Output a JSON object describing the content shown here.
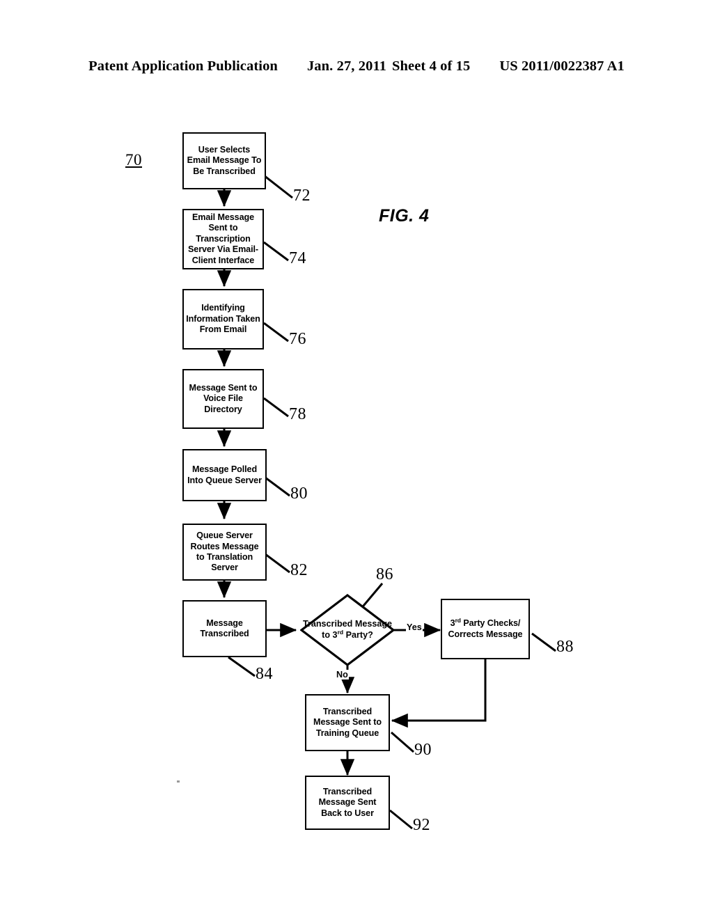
{
  "header": {
    "publication": "Patent Application Publication",
    "date": "Jan. 27, 2011",
    "sheet": "Sheet 4 of 15",
    "number": "US 2011/0022387 A1"
  },
  "figure": {
    "label": "FIG. 4",
    "diagram_ref": "70"
  },
  "flowchart": {
    "nodes": [
      {
        "id": "n72",
        "ref": "72",
        "type": "process",
        "text": "User Selects Email Message To Be Transcribed"
      },
      {
        "id": "n74",
        "ref": "74",
        "type": "process",
        "text": "Email Message Sent to Transcription Server Via Email-Client Interface"
      },
      {
        "id": "n76",
        "ref": "76",
        "type": "process",
        "text": "Identifying Information Taken From Email"
      },
      {
        "id": "n78",
        "ref": "78",
        "type": "process",
        "text": "Message Sent to Voice File Directory"
      },
      {
        "id": "n80",
        "ref": "80",
        "type": "process",
        "text": "Message Polled Into Queue Server"
      },
      {
        "id": "n82",
        "ref": "82",
        "type": "process",
        "text": "Queue Server Routes Message to Translation Server"
      },
      {
        "id": "n84",
        "ref": "84",
        "type": "process",
        "text": "Message Transcribed"
      },
      {
        "id": "n86",
        "ref": "86",
        "type": "decision",
        "text_pre": "Transcribed Message to 3",
        "text_sup": "rd",
        "text_post": " Party?"
      },
      {
        "id": "n88",
        "ref": "88",
        "type": "process",
        "text_pre": "3",
        "text_sup": "rd",
        "text_post": " Party Checks/ Corrects Message"
      },
      {
        "id": "n90",
        "ref": "90",
        "type": "process",
        "text": "Transcribed Message Sent to Training Queue"
      },
      {
        "id": "n92",
        "ref": "92",
        "type": "process",
        "text": "Transcribed Message Sent Back to User"
      }
    ],
    "branch_labels": {
      "yes": "Yes",
      "no": "No"
    },
    "callouts": [
      "72",
      "74",
      "76",
      "78",
      "80",
      "82",
      "84",
      "86",
      "88",
      "90",
      "92"
    ]
  },
  "colors": {
    "ink": "#000000",
    "paper": "#ffffff"
  }
}
